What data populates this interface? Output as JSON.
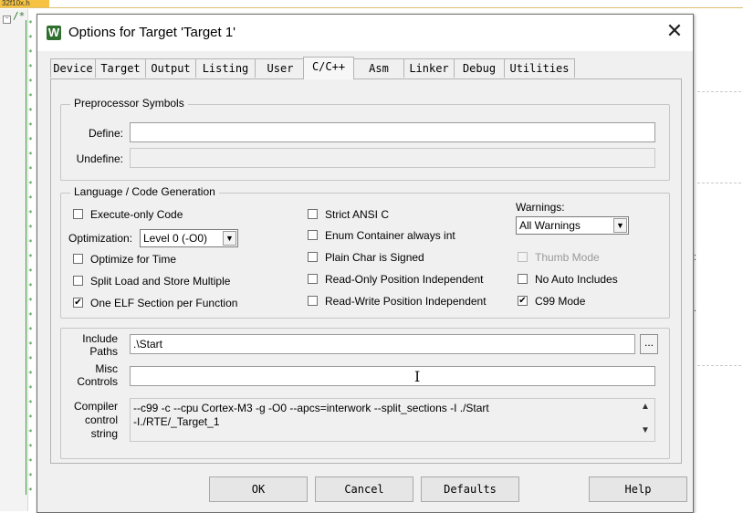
{
  "editor": {
    "tab_label": "32f10x.h",
    "first_line": "/*"
  },
  "dialog": {
    "title": "Options for Target 'Target 1'",
    "close_glyph": "✕",
    "tabs": [
      "Device",
      "Target",
      "Output",
      "Listing",
      "User",
      "C/C++",
      "Asm",
      "Linker",
      "Debug",
      "Utilities"
    ],
    "active_tab": "C/C++"
  },
  "preprocessor": {
    "legend": "Preprocessor Symbols",
    "define_label": "Define:",
    "define_value": "",
    "undefine_label": "Undefine:",
    "undefine_value": ""
  },
  "codegen": {
    "legend": "Language / Code Generation",
    "execute_only": {
      "label": "Execute-only Code",
      "checked": false
    },
    "optimization_label": "Optimization:",
    "optimization_value": "Level 0 (-O0)",
    "optimize_time": {
      "label": "Optimize for Time",
      "checked": false
    },
    "split_load": {
      "label": "Split Load and Store Multiple",
      "checked": false
    },
    "one_elf": {
      "label": "One ELF Section per Function",
      "checked": true
    },
    "strict_ansi": {
      "label": "Strict ANSI C",
      "checked": false
    },
    "enum_container": {
      "label": "Enum Container always int",
      "checked": false
    },
    "plain_char": {
      "label": "Plain Char is Signed",
      "checked": false
    },
    "ro_position": {
      "label": "Read-Only Position Independent",
      "checked": false
    },
    "rw_position": {
      "label": "Read-Write Position Independent",
      "checked": false
    },
    "warnings_label": "Warnings:",
    "warnings_value": "All Warnings",
    "thumb_mode": {
      "label": "Thumb Mode",
      "checked": false,
      "enabled": false
    },
    "no_auto_includes": {
      "label": "No Auto Includes",
      "checked": false
    },
    "c99_mode": {
      "label": "C99 Mode",
      "checked": true
    }
  },
  "paths": {
    "include_label_1": "Include",
    "include_label_2": "Paths",
    "include_value": ".\\Start",
    "browse_label": "...",
    "misc_label_1": "Misc",
    "misc_label_2": "Controls",
    "misc_value": "",
    "compiler_label_1": "Compiler",
    "compiler_label_2": "control",
    "compiler_label_3": "string",
    "compiler_value": "--c99 -c --cpu Cortex-M3 -g -O0 --apcs=interwork --split_sections -I ./Start\n-I./RTE/_Target_1"
  },
  "buttons": {
    "ok": "OK",
    "cancel": "Cancel",
    "defaults": "Defaults",
    "help": "Help"
  },
  "check_glyph": "✔",
  "dropdown_glyph": "▼",
  "scroll_up_glyph": "▲",
  "scroll_down_glyph": "▼"
}
